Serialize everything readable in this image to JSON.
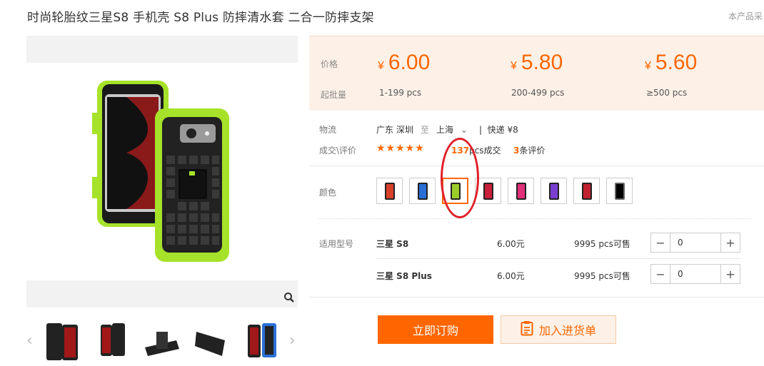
{
  "product": {
    "title": "时尚轮胎纹三星S8 手机壳 S8 Plus 防摔清水套 二合一防摔支架",
    "corner_note": "本产品采"
  },
  "price_panel": {
    "price_label": "价格",
    "moq_label": "起批量",
    "currency": "¥",
    "tiers": [
      {
        "price": "6.00",
        "range": "1-199 pcs"
      },
      {
        "price": "5.80",
        "range": "200-499 pcs"
      },
      {
        "price": "5.60",
        "range": "≥500 pcs"
      }
    ]
  },
  "logistics": {
    "label": "物流",
    "from": "广东 深圳",
    "to_word": "至",
    "to": "上海",
    "method": "快递 ¥8"
  },
  "deals": {
    "label": "成交\\评价",
    "stars": "★★★★★",
    "count": "137",
    "count_suffix": "pcs成交",
    "reviews": "3",
    "reviews_suffix": "条评价"
  },
  "color": {
    "label": "颜色",
    "swatch_colors": [
      "#d8402a",
      "#2a6fd6",
      "#9ccc2a",
      "#c8203a",
      "#e0307a",
      "#7a3fd0",
      "#e06a30",
      "#c02030",
      "#000000"
    ],
    "selected_index": 2
  },
  "models": {
    "label": "适用型号",
    "rows": [
      {
        "name": "三星 S8",
        "price": "6.00元",
        "stock": "9995 pcs可售",
        "qty": "0"
      },
      {
        "name": "三星 S8 Plus",
        "price": "6.00元",
        "stock": "9995 pcs可售",
        "qty": "0"
      }
    ],
    "minus": "−",
    "plus": "+"
  },
  "actions": {
    "buy": "立即订购",
    "cart": "加入进货单"
  },
  "colors": {
    "accent": "#ff6600",
    "phone_case_green": "#a6e22a"
  }
}
